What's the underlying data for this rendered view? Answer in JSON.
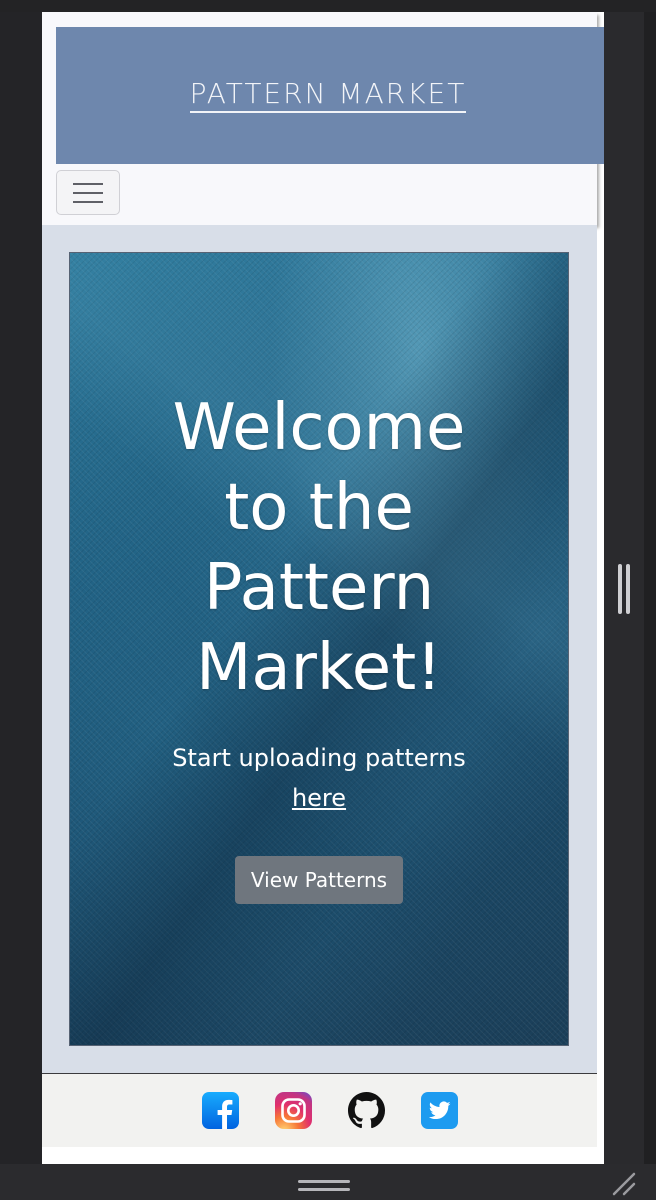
{
  "header": {
    "logo_text": "PATTERN MARKET",
    "nav_toggle_icon": "hamburger-icon"
  },
  "hero": {
    "title": "Welcome to the Pattern Market!",
    "subtitle": "Start uploading patterns",
    "subtitle_link": "here",
    "cta_label": "View Patterns"
  },
  "footer": {
    "social_links": [
      {
        "icon": "facebook-icon",
        "color": "#1877f2"
      },
      {
        "icon": "instagram-icon",
        "color": "#e1306c"
      },
      {
        "icon": "github-icon",
        "color": "#111111"
      },
      {
        "icon": "twitter-icon",
        "color": "#1da1f2"
      }
    ]
  },
  "colors": {
    "banner": "#6e87ad",
    "main_background": "#d8dee8",
    "button": "#6f767e"
  }
}
